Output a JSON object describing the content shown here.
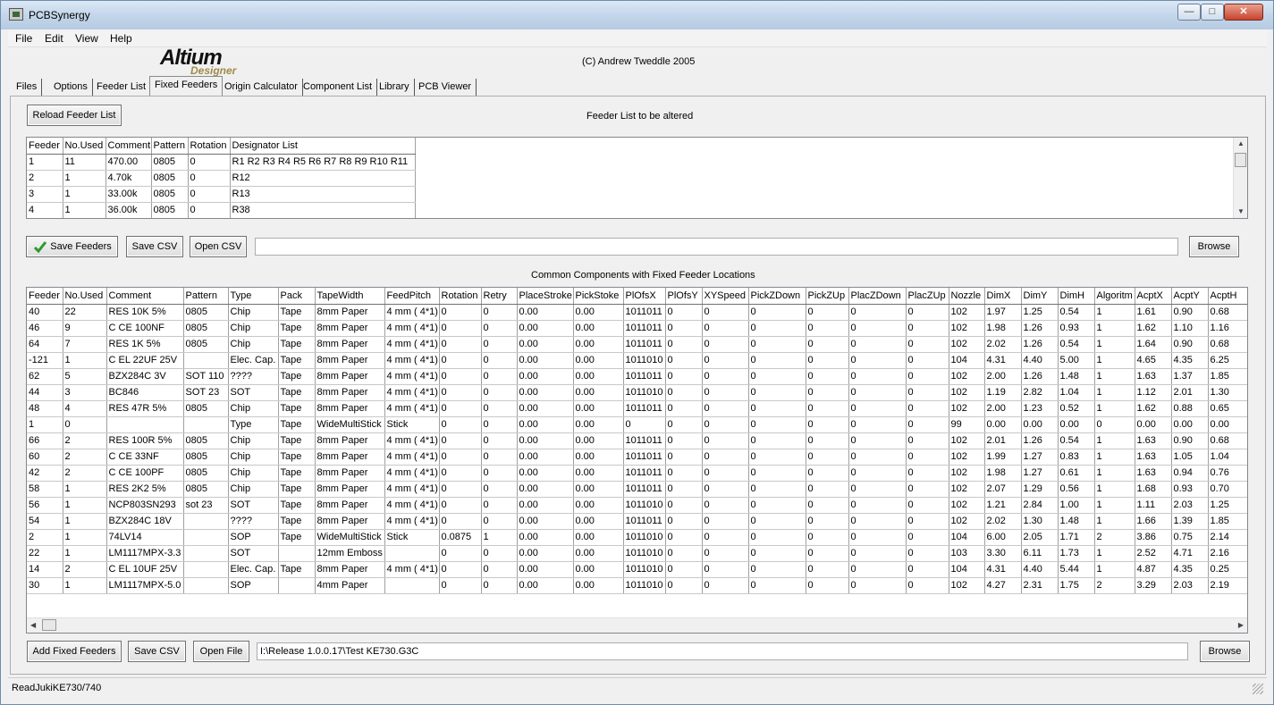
{
  "window": {
    "title": "PCBSynergy"
  },
  "menu": [
    "File",
    "Edit",
    "View",
    "Help"
  ],
  "logo": {
    "line1": "Altium",
    "line2": "Designer"
  },
  "copyright": "(C) Andrew Tweddle 2005",
  "tabs": [
    "Files",
    "Options",
    "Feeder List",
    "Fixed Feeders",
    "Origin Calculator",
    "Component List",
    "Library",
    "PCB Viewer"
  ],
  "feeder_section": {
    "reload_label": "Reload Feeder List",
    "title": "Feeder List to be altered",
    "columns": [
      "Feeder",
      "No.Used",
      "Comment",
      "Pattern",
      "Rotation",
      "Designator List"
    ],
    "rows": [
      [
        "1",
        "11",
        "470.00",
        "0805",
        "0",
        "R1 R2 R3 R4 R5 R6 R7 R8 R9 R10 R11"
      ],
      [
        "2",
        "1",
        "4.70k",
        "0805",
        "0",
        "R12"
      ],
      [
        "3",
        "1",
        "33.00k",
        "0805",
        "0",
        "R13"
      ],
      [
        "4",
        "1",
        "36.00k",
        "0805",
        "0",
        "R38"
      ]
    ],
    "save_feeders_label": "Save Feeders",
    "save_csv_label": "Save CSV",
    "open_csv_label": "Open CSV",
    "path_value": "",
    "browse_label": "Browse"
  },
  "fixed_section": {
    "title": "Common Components with Fixed Feeder Locations",
    "columns": [
      "Feeder",
      "No.Used",
      "Comment",
      "Pattern",
      "Type",
      "Pack",
      "TapeWidth",
      "FeedPitch",
      "Rotation",
      "Retry",
      "PlaceStroke",
      "PickStoke",
      "PlOfsX",
      "PlOfsY",
      "XYSpeed",
      "PickZDown",
      "PickZUp",
      "PlacZDown",
      "PlacZUp",
      "Nozzle",
      "DimX",
      "DimY",
      "DimH",
      "Algoritm",
      "AcptX",
      "AcptY",
      "AcptH"
    ],
    "rows": [
      [
        "40",
        "22",
        "RES 10K 5%",
        "0805",
        "Chip",
        "Tape",
        "8mm Paper",
        "4 mm ( 4*1)",
        "0",
        "0",
        "0.00",
        "0.00",
        "1011011",
        "0",
        "0",
        "0",
        "0",
        "0",
        "0",
        "102",
        "1.97",
        "1.25",
        "0.54",
        "1",
        "1.61",
        "0.90",
        "0.68"
      ],
      [
        "46",
        "9",
        "C CE 100NF",
        "0805",
        "Chip",
        "Tape",
        "8mm Paper",
        "4 mm ( 4*1)",
        "0",
        "0",
        "0.00",
        "0.00",
        "1011011",
        "0",
        "0",
        "0",
        "0",
        "0",
        "0",
        "102",
        "1.98",
        "1.26",
        "0.93",
        "1",
        "1.62",
        "1.10",
        "1.16"
      ],
      [
        "64",
        "7",
        "RES 1K 5%",
        "0805",
        "Chip",
        "Tape",
        "8mm Paper",
        "4 mm ( 4*1)",
        "0",
        "0",
        "0.00",
        "0.00",
        "1011011",
        "0",
        "0",
        "0",
        "0",
        "0",
        "0",
        "102",
        "2.02",
        "1.26",
        "0.54",
        "1",
        "1.64",
        "0.90",
        "0.68"
      ],
      [
        "-121",
        "1",
        "C EL 22UF 25V",
        "",
        "Elec. Cap.",
        "Tape",
        "8mm Paper",
        "4 mm ( 4*1)",
        "0",
        "0",
        "0.00",
        "0.00",
        "1011010",
        "0",
        "0",
        "0",
        "0",
        "0",
        "0",
        "104",
        "4.31",
        "4.40",
        "5.00",
        "1",
        "4.65",
        "4.35",
        "6.25"
      ],
      [
        "62",
        "5",
        "BZX284C 3V",
        "SOT 110",
        "????",
        "Tape",
        "8mm Paper",
        "4 mm ( 4*1)",
        "0",
        "0",
        "0.00",
        "0.00",
        "1011011",
        "0",
        "0",
        "0",
        "0",
        "0",
        "0",
        "102",
        "2.00",
        "1.26",
        "1.48",
        "1",
        "1.63",
        "1.37",
        "1.85"
      ],
      [
        "44",
        "3",
        "BC846",
        "SOT 23",
        "SOT",
        "Tape",
        "8mm Paper",
        "4 mm ( 4*1)",
        "0",
        "0",
        "0.00",
        "0.00",
        "1011010",
        "0",
        "0",
        "0",
        "0",
        "0",
        "0",
        "102",
        "1.19",
        "2.82",
        "1.04",
        "1",
        "1.12",
        "2.01",
        "1.30"
      ],
      [
        "48",
        "4",
        "RES 47R 5%",
        "0805",
        "Chip",
        "Tape",
        "8mm Paper",
        "4 mm ( 4*1)",
        "0",
        "0",
        "0.00",
        "0.00",
        "1011011",
        "0",
        "0",
        "0",
        "0",
        "0",
        "0",
        "102",
        "2.00",
        "1.23",
        "0.52",
        "1",
        "1.62",
        "0.88",
        "0.65"
      ],
      [
        "1",
        "0",
        "",
        "",
        "Type",
        "Tape",
        "WideMultiStick",
        "Stick",
        "0",
        "0",
        "0.00",
        "0.00",
        "0",
        "0",
        "0",
        "0",
        "0",
        "0",
        "0",
        "99",
        "0.00",
        "0.00",
        "0.00",
        "0",
        "0.00",
        "0.00",
        "0.00"
      ],
      [
        "66",
        "2",
        "RES 100R 5%",
        "0805",
        "Chip",
        "Tape",
        "8mm Paper",
        "4 mm ( 4*1)",
        "0",
        "0",
        "0.00",
        "0.00",
        "1011011",
        "0",
        "0",
        "0",
        "0",
        "0",
        "0",
        "102",
        "2.01",
        "1.26",
        "0.54",
        "1",
        "1.63",
        "0.90",
        "0.68"
      ],
      [
        "60",
        "2",
        "C CE 33NF",
        "0805",
        "Chip",
        "Tape",
        "8mm Paper",
        "4 mm ( 4*1)",
        "0",
        "0",
        "0.00",
        "0.00",
        "1011011",
        "0",
        "0",
        "0",
        "0",
        "0",
        "0",
        "102",
        "1.99",
        "1.27",
        "0.83",
        "1",
        "1.63",
        "1.05",
        "1.04"
      ],
      [
        "42",
        "2",
        "C CE 100PF",
        "0805",
        "Chip",
        "Tape",
        "8mm Paper",
        "4 mm ( 4*1)",
        "0",
        "0",
        "0.00",
        "0.00",
        "1011011",
        "0",
        "0",
        "0",
        "0",
        "0",
        "0",
        "102",
        "1.98",
        "1.27",
        "0.61",
        "1",
        "1.63",
        "0.94",
        "0.76"
      ],
      [
        "58",
        "1",
        "RES 2K2 5%",
        "0805",
        "Chip",
        "Tape",
        "8mm Paper",
        "4 mm ( 4*1)",
        "0",
        "0",
        "0.00",
        "0.00",
        "1011011",
        "0",
        "0",
        "0",
        "0",
        "0",
        "0",
        "102",
        "2.07",
        "1.29",
        "0.56",
        "1",
        "1.68",
        "0.93",
        "0.70"
      ],
      [
        "56",
        "1",
        "NCP803SN293",
        "sot 23",
        "SOT",
        "Tape",
        "8mm Paper",
        "4 mm ( 4*1)",
        "0",
        "0",
        "0.00",
        "0.00",
        "1011010",
        "0",
        "0",
        "0",
        "0",
        "0",
        "0",
        "102",
        "1.21",
        "2.84",
        "1.00",
        "1",
        "1.11",
        "2.03",
        "1.25"
      ],
      [
        "54",
        "1",
        "BZX284C 18V",
        "",
        "????",
        "Tape",
        "8mm Paper",
        "4 mm ( 4*1)",
        "0",
        "0",
        "0.00",
        "0.00",
        "1011011",
        "0",
        "0",
        "0",
        "0",
        "0",
        "0",
        "102",
        "2.02",
        "1.30",
        "1.48",
        "1",
        "1.66",
        "1.39",
        "1.85"
      ],
      [
        "2",
        "1",
        "74LV14",
        "",
        "SOP",
        "Tape",
        "WideMultiStick",
        "Stick",
        "0.0875",
        "1",
        "0.00",
        "0.00",
        "1011010",
        "0",
        "0",
        "0",
        "0",
        "0",
        "0",
        "104",
        "6.00",
        "2.05",
        "1.71",
        "2",
        "3.86",
        "0.75",
        "2.14"
      ],
      [
        "22",
        "1",
        "LM1117MPX-3.3",
        "",
        "SOT",
        "",
        "12mm Emboss",
        "",
        "0",
        "0",
        "0.00",
        "0.00",
        "1011010",
        "0",
        "0",
        "0",
        "0",
        "0",
        "0",
        "103",
        "3.30",
        "6.11",
        "1.73",
        "1",
        "2.52",
        "4.71",
        "2.16"
      ],
      [
        "14",
        "2",
        "C EL 10UF 25V",
        "",
        "Elec. Cap.",
        "Tape",
        "8mm Paper",
        "4 mm ( 4*1)",
        "0",
        "0",
        "0.00",
        "0.00",
        "1011010",
        "0",
        "0",
        "0",
        "0",
        "0",
        "0",
        "104",
        "4.31",
        "4.40",
        "5.44",
        "1",
        "4.87",
        "4.35",
        "0.25"
      ],
      [
        "30",
        "1",
        "LM1117MPX-5.0",
        "",
        "SOP",
        "",
        "4mm Paper",
        "",
        "0",
        "0",
        "0.00",
        "0.00",
        "1011010",
        "0",
        "0",
        "0",
        "0",
        "0",
        "0",
        "102",
        "4.27",
        "2.31",
        "1.75",
        "2",
        "3.29",
        "2.03",
        "2.19"
      ]
    ],
    "add_label": "Add Fixed Feeders",
    "save_csv_label": "Save CSV",
    "open_file_label": "Open File",
    "file_path": "I:\\Release 1.0.0.17\\Test KE730.G3C",
    "browse_label": "Browse"
  },
  "status": "ReadJukiKE730/740",
  "colors": {
    "check": "#2a9a2a",
    "close": "#c7442e"
  }
}
